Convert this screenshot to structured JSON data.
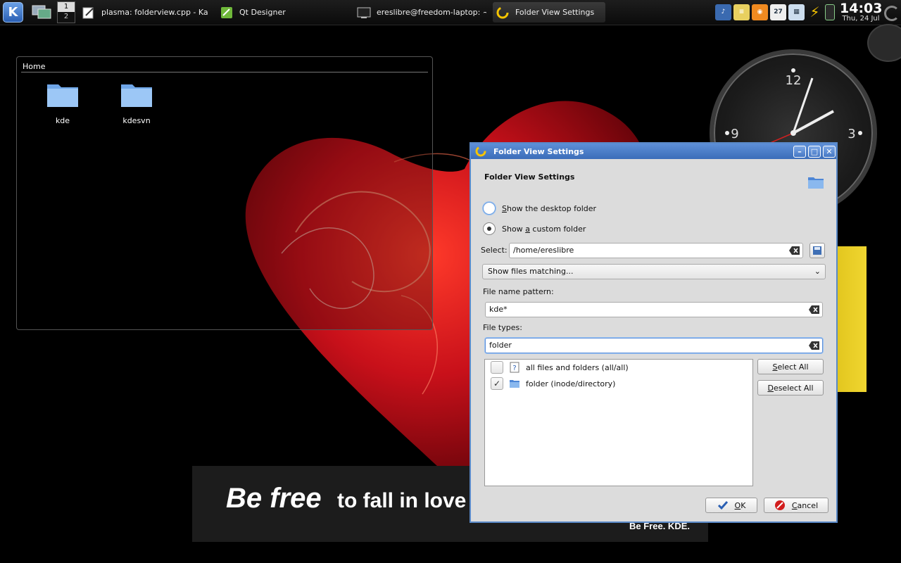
{
  "panel": {
    "pager": [
      "1",
      "2"
    ],
    "tasks": [
      {
        "label": "plasma: folderview.cpp - Kate",
        "icon": "kate-icon"
      },
      {
        "label": "Qt Designer",
        "icon": "qt-designer-icon"
      },
      {
        "label": "ereslibre@freedom-laptop: ~/kd",
        "icon": "terminal-icon"
      },
      {
        "label": "Folder View Settings",
        "icon": "plasma-icon"
      }
    ],
    "tray_calendar_day": "27",
    "clock": {
      "time": "14:03",
      "date": "Thu, 24 Jul"
    }
  },
  "folderview": {
    "title": "Home",
    "items": [
      {
        "label": "kde",
        "icon": "folder-icon"
      },
      {
        "label": "kdesvn",
        "icon": "folder-icon"
      }
    ]
  },
  "analog_clock": {
    "numerals": [
      "12",
      "9",
      "3"
    ]
  },
  "wallpaper": {
    "big": "Be free",
    "small": "to fall in love",
    "tag": "Be Free.  KDE."
  },
  "dialog": {
    "title": "Folder View Settings",
    "header": "Folder View Settings",
    "radio_desktop": {
      "prefix": "",
      "accel": "S",
      "suffix": "how the desktop folder",
      "selected": false
    },
    "radio_custom": {
      "prefix": "Show ",
      "accel": "a",
      "suffix": " custom folder",
      "selected": true
    },
    "select_label": "Select:",
    "select_value": "/home/ereslibre",
    "filter_combo": "Show files matching...",
    "pattern_label": "File name pattern:",
    "pattern_value": "kde*",
    "types_label": "File types:",
    "types_value": "folder",
    "types": [
      {
        "label": "all files and folders (all/all)",
        "checked": false,
        "icon": "unknown-mime-icon"
      },
      {
        "label": "folder (inode/directory)",
        "checked": true,
        "icon": "folder-icon"
      }
    ],
    "select_all": {
      "prefix": "",
      "accel": "S",
      "suffix": "elect All"
    },
    "deselect_all": {
      "prefix": "",
      "accel": "D",
      "suffix": "eselect All"
    },
    "ok": {
      "accel": "O",
      "suffix": "K"
    },
    "cancel": {
      "accel": "C",
      "suffix": "ancel"
    }
  },
  "colors": {
    "titlebar": "#4a7dc9",
    "dialog_bg": "#dcdcdc",
    "heart": "#c8101a"
  }
}
